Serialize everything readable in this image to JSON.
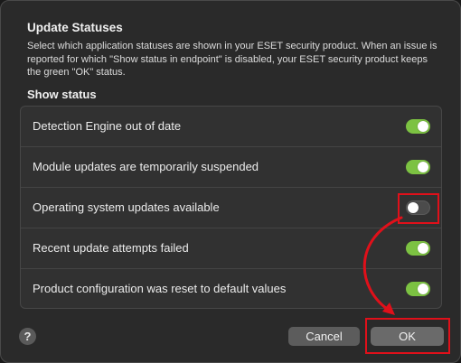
{
  "dialog": {
    "title": "Update Statuses",
    "description": "Select which application statuses are shown in your ESET security product. When an issue is reported for which \"Show status in endpoint\" is disabled, your ESET security product keeps the green \"OK\" status.",
    "section_title": "Show status"
  },
  "statuses": [
    {
      "label": "Detection Engine out of date",
      "enabled": true
    },
    {
      "label": "Module updates are temporarily suspended",
      "enabled": true
    },
    {
      "label": "Operating system updates available",
      "enabled": false
    },
    {
      "label": "Recent update attempts failed",
      "enabled": true
    },
    {
      "label": "Product configuration was reset to default values",
      "enabled": true
    }
  ],
  "footer": {
    "help_label": "?",
    "cancel_label": "Cancel",
    "ok_label": "OK"
  },
  "colors": {
    "toggle_on": "#7cc242",
    "toggle_off": "#4b4b4b",
    "annotation": "#e0101a"
  },
  "icons": {
    "help": "question-mark-icon",
    "annotation_arrow": "curved-arrow-icon"
  }
}
